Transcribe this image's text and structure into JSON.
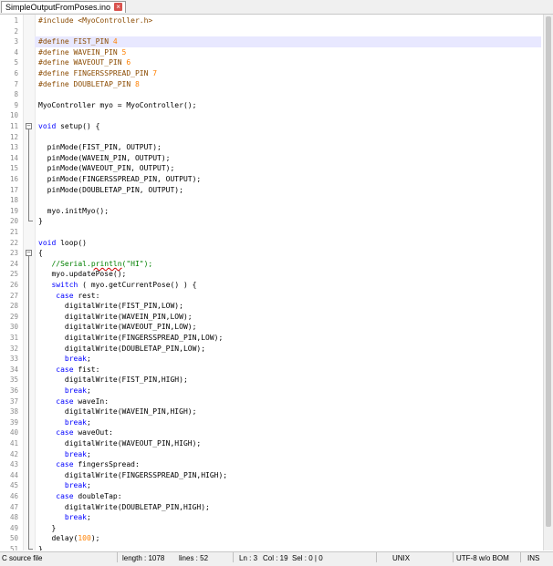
{
  "tab": {
    "title": "SimpleOutputFromPoses.ino"
  },
  "lines": [
    "#include <MyoController.h>",
    "",
    "#define FIST_PIN 4",
    "#define WAVEIN_PIN 5",
    "#define WAVEOUT_PIN 6",
    "#define FINGERSSPREAD_PIN 7",
    "#define DOUBLETAP_PIN 8",
    "",
    "MyoController myo = MyoController();",
    "",
    "void setup() {",
    "",
    "  pinMode(FIST_PIN, OUTPUT);",
    "  pinMode(WAVEIN_PIN, OUTPUT);",
    "  pinMode(WAVEOUT_PIN, OUTPUT);",
    "  pinMode(FINGERSSPREAD_PIN, OUTPUT);",
    "  pinMode(DOUBLETAP_PIN, OUTPUT);",
    "",
    "  myo.initMyo();",
    "}",
    "",
    "void loop()",
    "{",
    "   //Serial.println(\"HI\");",
    "   myo.updatePose();",
    "   switch ( myo.getCurrentPose() ) {",
    "    case rest:",
    "      digitalWrite(FIST_PIN,LOW);",
    "      digitalWrite(WAVEIN_PIN,LOW);",
    "      digitalWrite(WAVEOUT_PIN,LOW);",
    "      digitalWrite(FINGERSSPREAD_PIN,LOW);",
    "      digitalWrite(DOUBLETAP_PIN,LOW);",
    "      break;",
    "    case fist:",
    "      digitalWrite(FIST_PIN,HIGH);",
    "      break;",
    "    case waveIn:",
    "      digitalWrite(WAVEIN_PIN,HIGH);",
    "      break;",
    "    case waveOut:",
    "      digitalWrite(WAVEOUT_PIN,HIGH);",
    "      break;",
    "    case fingersSpread:",
    "      digitalWrite(FINGERSSPREAD_PIN,HIGH);",
    "      break;",
    "    case doubleTap:",
    "      digitalWrite(DOUBLETAP_PIN,HIGH);",
    "      break;",
    "   }",
    "   delay(100);",
    "}"
  ],
  "current_line": 3,
  "status": {
    "file_type": "C source file",
    "length": "length : 1078",
    "lines": "lines : 52",
    "ln": "Ln : 3",
    "col": "Col : 19",
    "sel": "Sel : 0 | 0",
    "eol": "UNIX",
    "encoding": "UTF-8 w/o BOM",
    "mode": "INS"
  },
  "colors": {
    "preprocessor": "#8a4a00",
    "keyword": "#0000ff",
    "number": "#ff8000",
    "comment": "#008000",
    "current_line_bg": "#e8e8ff"
  }
}
